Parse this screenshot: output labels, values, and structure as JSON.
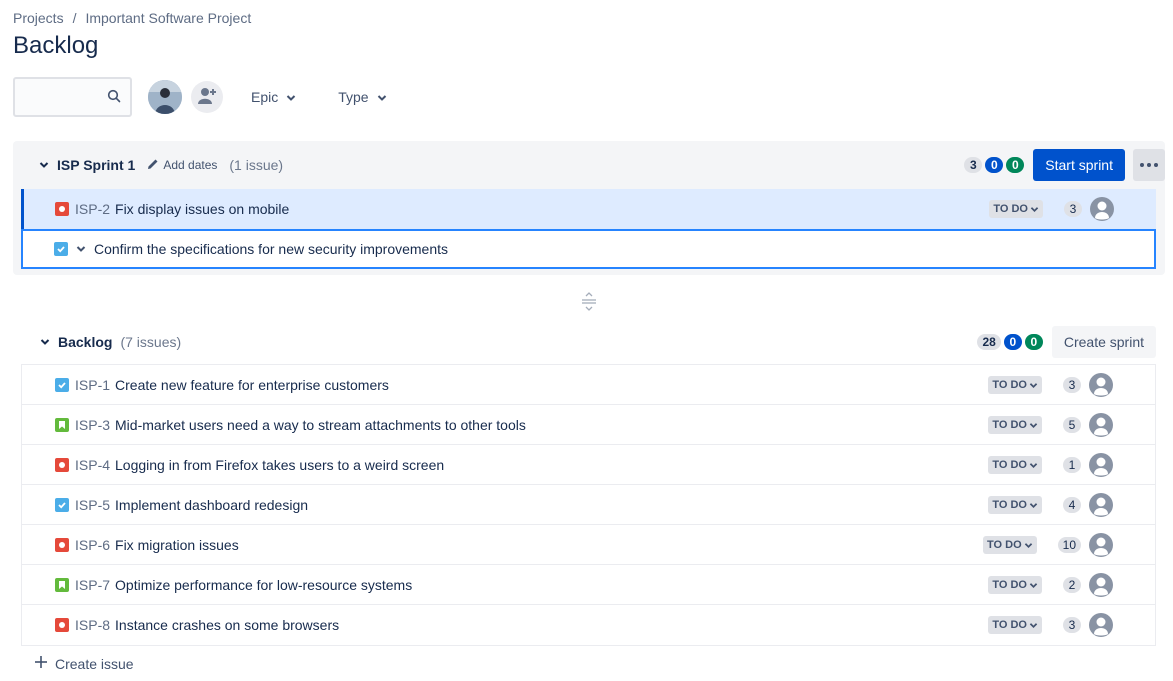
{
  "breadcrumb": {
    "items": [
      "Projects",
      "Important Software Project"
    ],
    "separator": "/"
  },
  "page_title": "Backlog",
  "toolbar": {
    "search_placeholder": "",
    "search_value": "",
    "filters": [
      {
        "label": "Epic"
      },
      {
        "label": "Type"
      }
    ]
  },
  "sprint": {
    "name": "ISP Sprint 1",
    "add_dates_label": "Add dates",
    "issue_count": "(1 issue)",
    "counts": {
      "todo": "3",
      "in_progress": "0",
      "done": "0"
    },
    "start_button": "Start sprint",
    "issues": [
      {
        "type": "bug",
        "key": "ISP-2",
        "summary": "Fix display issues on mobile",
        "status": "TO DO",
        "estimate": "3",
        "selected": true
      }
    ],
    "new_issue": {
      "type": "task",
      "value": "Confirm the specifications for new security improvements"
    }
  },
  "backlog": {
    "name": "Backlog",
    "issue_count": "(7 issues)",
    "counts": {
      "todo": "28",
      "in_progress": "0",
      "done": "0"
    },
    "create_sprint_button": "Create sprint",
    "issues": [
      {
        "type": "task",
        "key": "ISP-1",
        "summary": "Create new feature for enterprise customers",
        "status": "TO DO",
        "estimate": "3"
      },
      {
        "type": "story",
        "key": "ISP-3",
        "summary": "Mid-market users need a way to stream attachments to other tools",
        "status": "TO DO",
        "estimate": "5"
      },
      {
        "type": "bug",
        "key": "ISP-4",
        "summary": "Logging in from Firefox takes users to a weird screen",
        "status": "TO DO",
        "estimate": "1"
      },
      {
        "type": "task",
        "key": "ISP-5",
        "summary": "Implement dashboard redesign",
        "status": "TO DO",
        "estimate": "4"
      },
      {
        "type": "bug",
        "key": "ISP-6",
        "summary": "Fix migration issues",
        "status": "TO DO",
        "estimate": "10"
      },
      {
        "type": "story",
        "key": "ISP-7",
        "summary": "Optimize performance for low-resource systems",
        "status": "TO DO",
        "estimate": "2"
      },
      {
        "type": "bug",
        "key": "ISP-8",
        "summary": "Instance crashes on some browsers",
        "status": "TO DO",
        "estimate": "3"
      }
    ],
    "create_issue_label": "Create issue"
  },
  "colors": {
    "primary": "#0052cc",
    "done": "#00875a",
    "bug": "#e5493a",
    "task": "#4bade8",
    "story": "#63ba3c",
    "selected_row": "#deebff",
    "focus_border": "#2684ff"
  }
}
